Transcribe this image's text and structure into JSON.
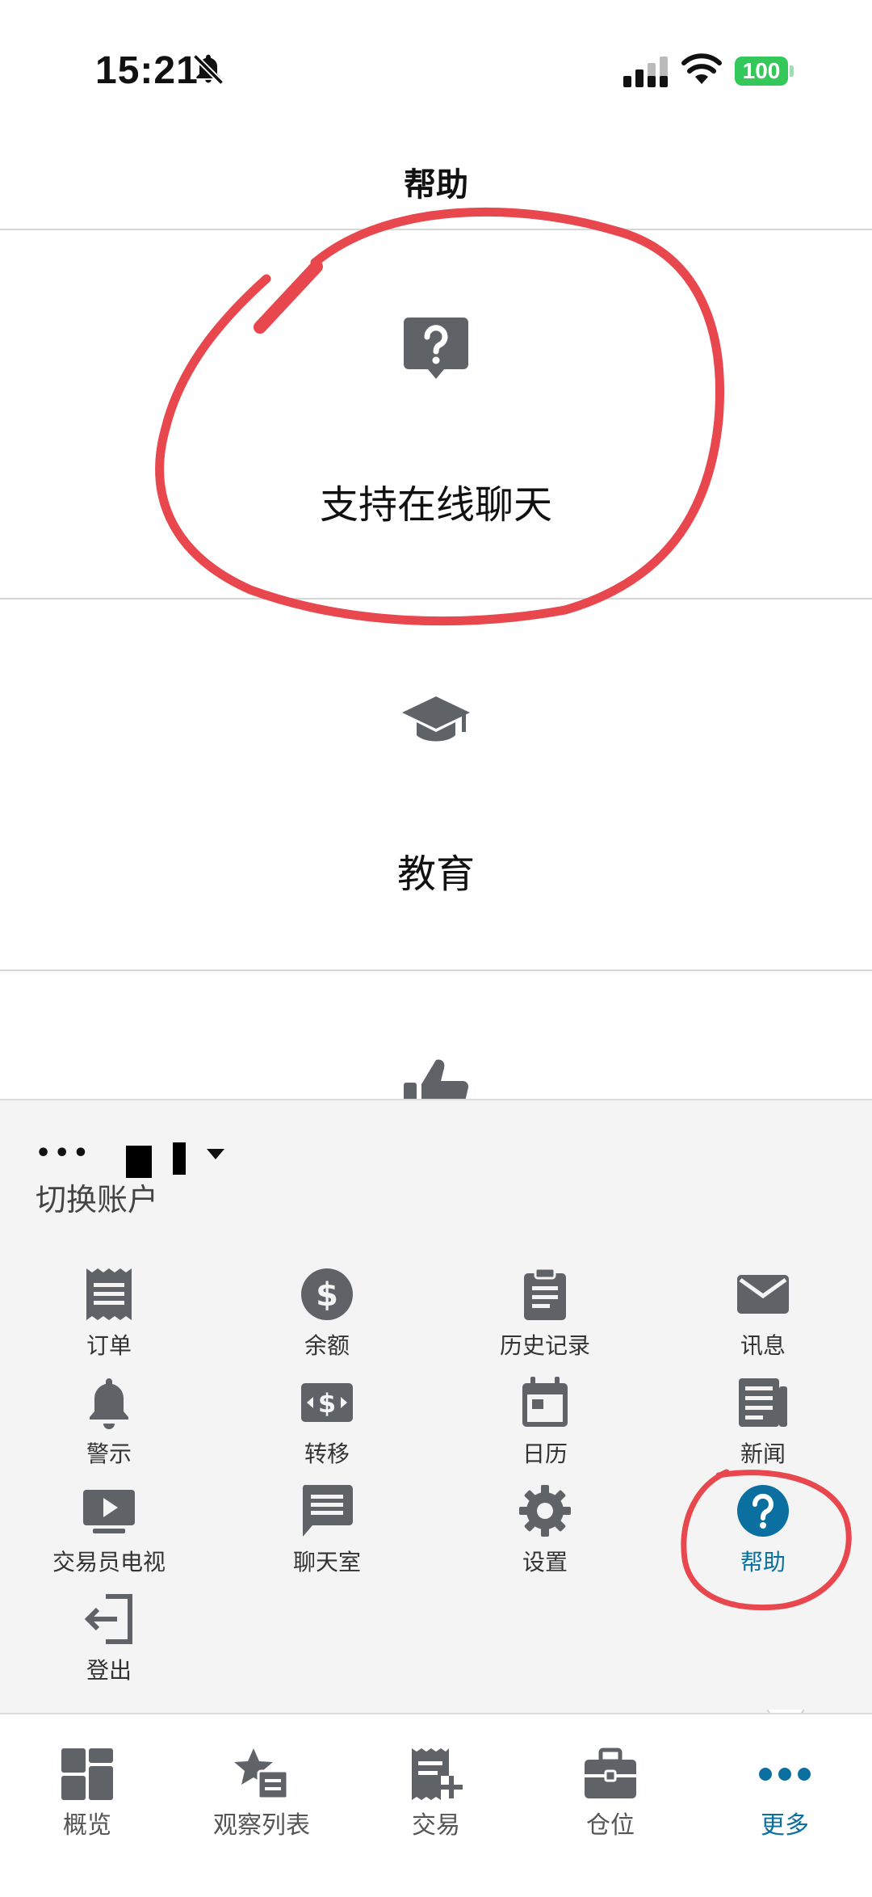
{
  "status_bar": {
    "time": "15:21",
    "battery": "100"
  },
  "page": {
    "title": "帮助"
  },
  "help_items": [
    {
      "label": "支持在线聊天",
      "icon": "help-chat-icon"
    },
    {
      "label": "教育",
      "icon": "graduation-cap-icon"
    },
    {
      "label": "",
      "icon": "thumbs-up-icon"
    }
  ],
  "account": {
    "masked": "•••",
    "switch_label": "切换账户"
  },
  "menu": [
    {
      "label": "订单",
      "icon": "receipt-icon"
    },
    {
      "label": "余额",
      "icon": "dollar-icon"
    },
    {
      "label": "历史记录",
      "icon": "clipboard-icon"
    },
    {
      "label": "讯息",
      "icon": "envelope-icon"
    },
    {
      "label": "警示",
      "icon": "bell-icon"
    },
    {
      "label": "转移",
      "icon": "money-transfer-icon"
    },
    {
      "label": "日历",
      "icon": "calendar-icon"
    },
    {
      "label": "新闻",
      "icon": "newspaper-icon"
    },
    {
      "label": "交易员电视",
      "icon": "tv-play-icon"
    },
    {
      "label": "聊天室",
      "icon": "chat-bubble-icon"
    },
    {
      "label": "设置",
      "icon": "gear-icon"
    },
    {
      "label": "帮助",
      "icon": "question-icon",
      "active": true
    },
    {
      "label": "登出",
      "icon": "logout-icon"
    }
  ],
  "tabs": [
    {
      "label": "概览",
      "icon": "dashboard-icon"
    },
    {
      "label": "观察列表",
      "icon": "watchlist-icon"
    },
    {
      "label": "交易",
      "icon": "trade-icon"
    },
    {
      "label": "仓位",
      "icon": "briefcase-icon"
    },
    {
      "label": "更多",
      "icon": "more-dots-icon",
      "active": true
    }
  ],
  "colors": {
    "accent": "#0b6fa0",
    "icon_gray": "#5f6368",
    "annotation_red": "#e8474e",
    "battery_green": "#34c759"
  }
}
